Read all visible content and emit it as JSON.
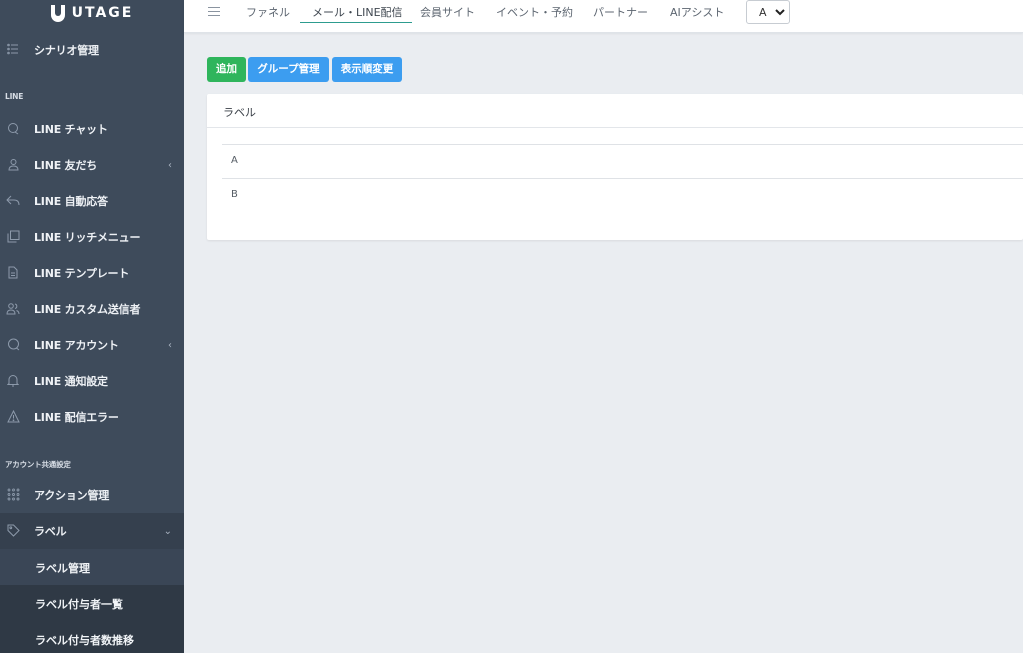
{
  "app": {
    "logo": "UTAGE"
  },
  "sidebar": {
    "top_item": {
      "label": "シナリオ管理",
      "icon": "list-icon"
    },
    "line_section": "LINE",
    "line_items": [
      {
        "label": "LINE チャット",
        "icon": "chat-icon",
        "chevron": ""
      },
      {
        "label": "LINE 友だち",
        "icon": "user-icon",
        "chevron": "‹"
      },
      {
        "label": "LINE 自動応答",
        "icon": "reply-icon",
        "chevron": ""
      },
      {
        "label": "LINE リッチメニュー",
        "icon": "cards-icon",
        "chevron": ""
      },
      {
        "label": "LINE テンプレート",
        "icon": "file-icon",
        "chevron": ""
      },
      {
        "label": "LINE カスタム送信者",
        "icon": "users-icon",
        "chevron": ""
      },
      {
        "label": "LINE アカウント",
        "icon": "comment-icon",
        "chevron": "‹"
      },
      {
        "label": "LINE 通知設定",
        "icon": "bell-icon",
        "chevron": ""
      },
      {
        "label": "LINE 配信エラー",
        "icon": "warning-icon",
        "chevron": ""
      }
    ],
    "account_section": "アカウント共通設定",
    "account_items": [
      {
        "label": "アクション管理",
        "icon": "grid-icon",
        "chevron": ""
      },
      {
        "label": "ラベル",
        "icon": "tag-icon",
        "chevron": "⌄"
      }
    ],
    "sub_items": [
      {
        "label": "ラベル管理"
      },
      {
        "label": "ラベル付与者一覧"
      },
      {
        "label": "ラベル付与者数推移"
      }
    ]
  },
  "header": {
    "tabs": [
      {
        "label": "ファネル"
      },
      {
        "label": "メール・LINE配信"
      },
      {
        "label": "会員サイト"
      },
      {
        "label": "イベント・予約"
      },
      {
        "label": "パートナー"
      },
      {
        "label": "AIアシスト"
      }
    ],
    "select_value": "A"
  },
  "toolbar": {
    "add_label": "追加",
    "group_label": "グループ管理",
    "order_label": "表示順変更"
  },
  "table": {
    "header": "ラベル",
    "rows": [
      "A",
      "B"
    ]
  },
  "colors": {
    "sidebar_bg": "#3e4b5b",
    "accent_green": "#2fb55c",
    "accent_blue": "#3c9df0",
    "tab_underline": "#2d9c8f"
  }
}
